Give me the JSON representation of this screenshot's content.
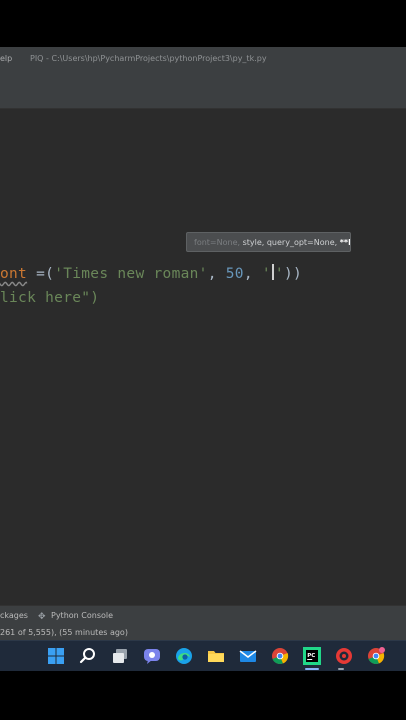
{
  "window": {
    "menu_fragment": "elp",
    "title_path": "PIQ - C:\\Users\\hp\\PycharmProjects\\pythonProject3\\py_tk.py"
  },
  "editor": {
    "line1": {
      "param": "ont",
      "assign": " =(",
      "str1": "'Times new roman'",
      "sep": ", ",
      "num": "50",
      "sep2": ", ",
      "quote_open": "'",
      "quote_close": "'",
      "close": "))"
    },
    "line2": {
      "text": "lick here\")"
    },
    "tooltip": {
      "faded": "font=None, ",
      "text": "style, query_opt=None, ",
      "bold": "**kw"
    }
  },
  "bottom_tools": {
    "packages_fragment": "ckages",
    "python_console": "Python Console"
  },
  "statusbar": {
    "text": "261 of 5,555), (55 minutes ago)"
  },
  "taskbar": {
    "icons": [
      "windows-start-icon",
      "search-icon",
      "task-view-icon",
      "chat-icon",
      "edge-icon",
      "file-explorer-icon",
      "mail-icon",
      "chrome-icon",
      "pycharm-icon",
      "media-icon",
      "chrome-alt-icon"
    ]
  },
  "colors": {
    "editor_bg": "#2b2b2b",
    "keyword_param": "#cc7832",
    "string": "#6a8759",
    "number": "#6897bb",
    "text": "#a9b7c6",
    "taskbar_bg": "#1f2a3a"
  }
}
